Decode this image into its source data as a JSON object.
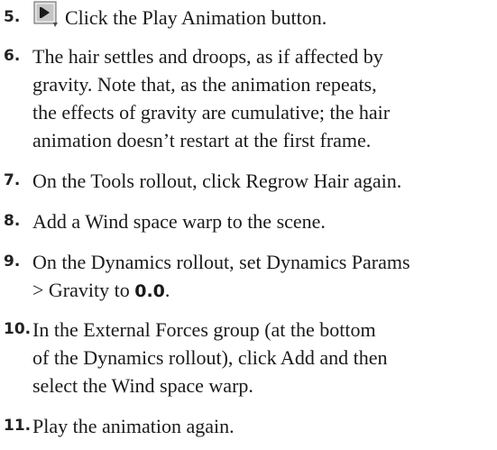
{
  "steps": [
    {
      "number": "5.",
      "text": "Click the Play Animation button.",
      "icon": "play-animation-icon"
    },
    {
      "number": "6.",
      "lines": [
        "The hair settles and droops, as if affected by",
        "gravity. Note that, as the animation repeats,",
        "the effects of gravity are cumulative; the hair",
        "animation doesn’t restart at the first frame."
      ]
    },
    {
      "number": "7.",
      "text": "On the Tools rollout, click Regrow Hair again."
    },
    {
      "number": "8.",
      "text": "Add a Wind space warp to the scene."
    },
    {
      "number": "9.",
      "line1": "On the Dynamics rollout, set Dynamics Params",
      "line2_prefix": "> Gravity to ",
      "line2_value": "0.0",
      "line2_suffix": "."
    },
    {
      "number": "10.",
      "lines": [
        "In the External Forces group (at the bottom",
        "of the Dynamics rollout), click Add and then",
        "select the Wind space warp."
      ]
    },
    {
      "number": "11.",
      "text": "Play the animation again."
    }
  ]
}
